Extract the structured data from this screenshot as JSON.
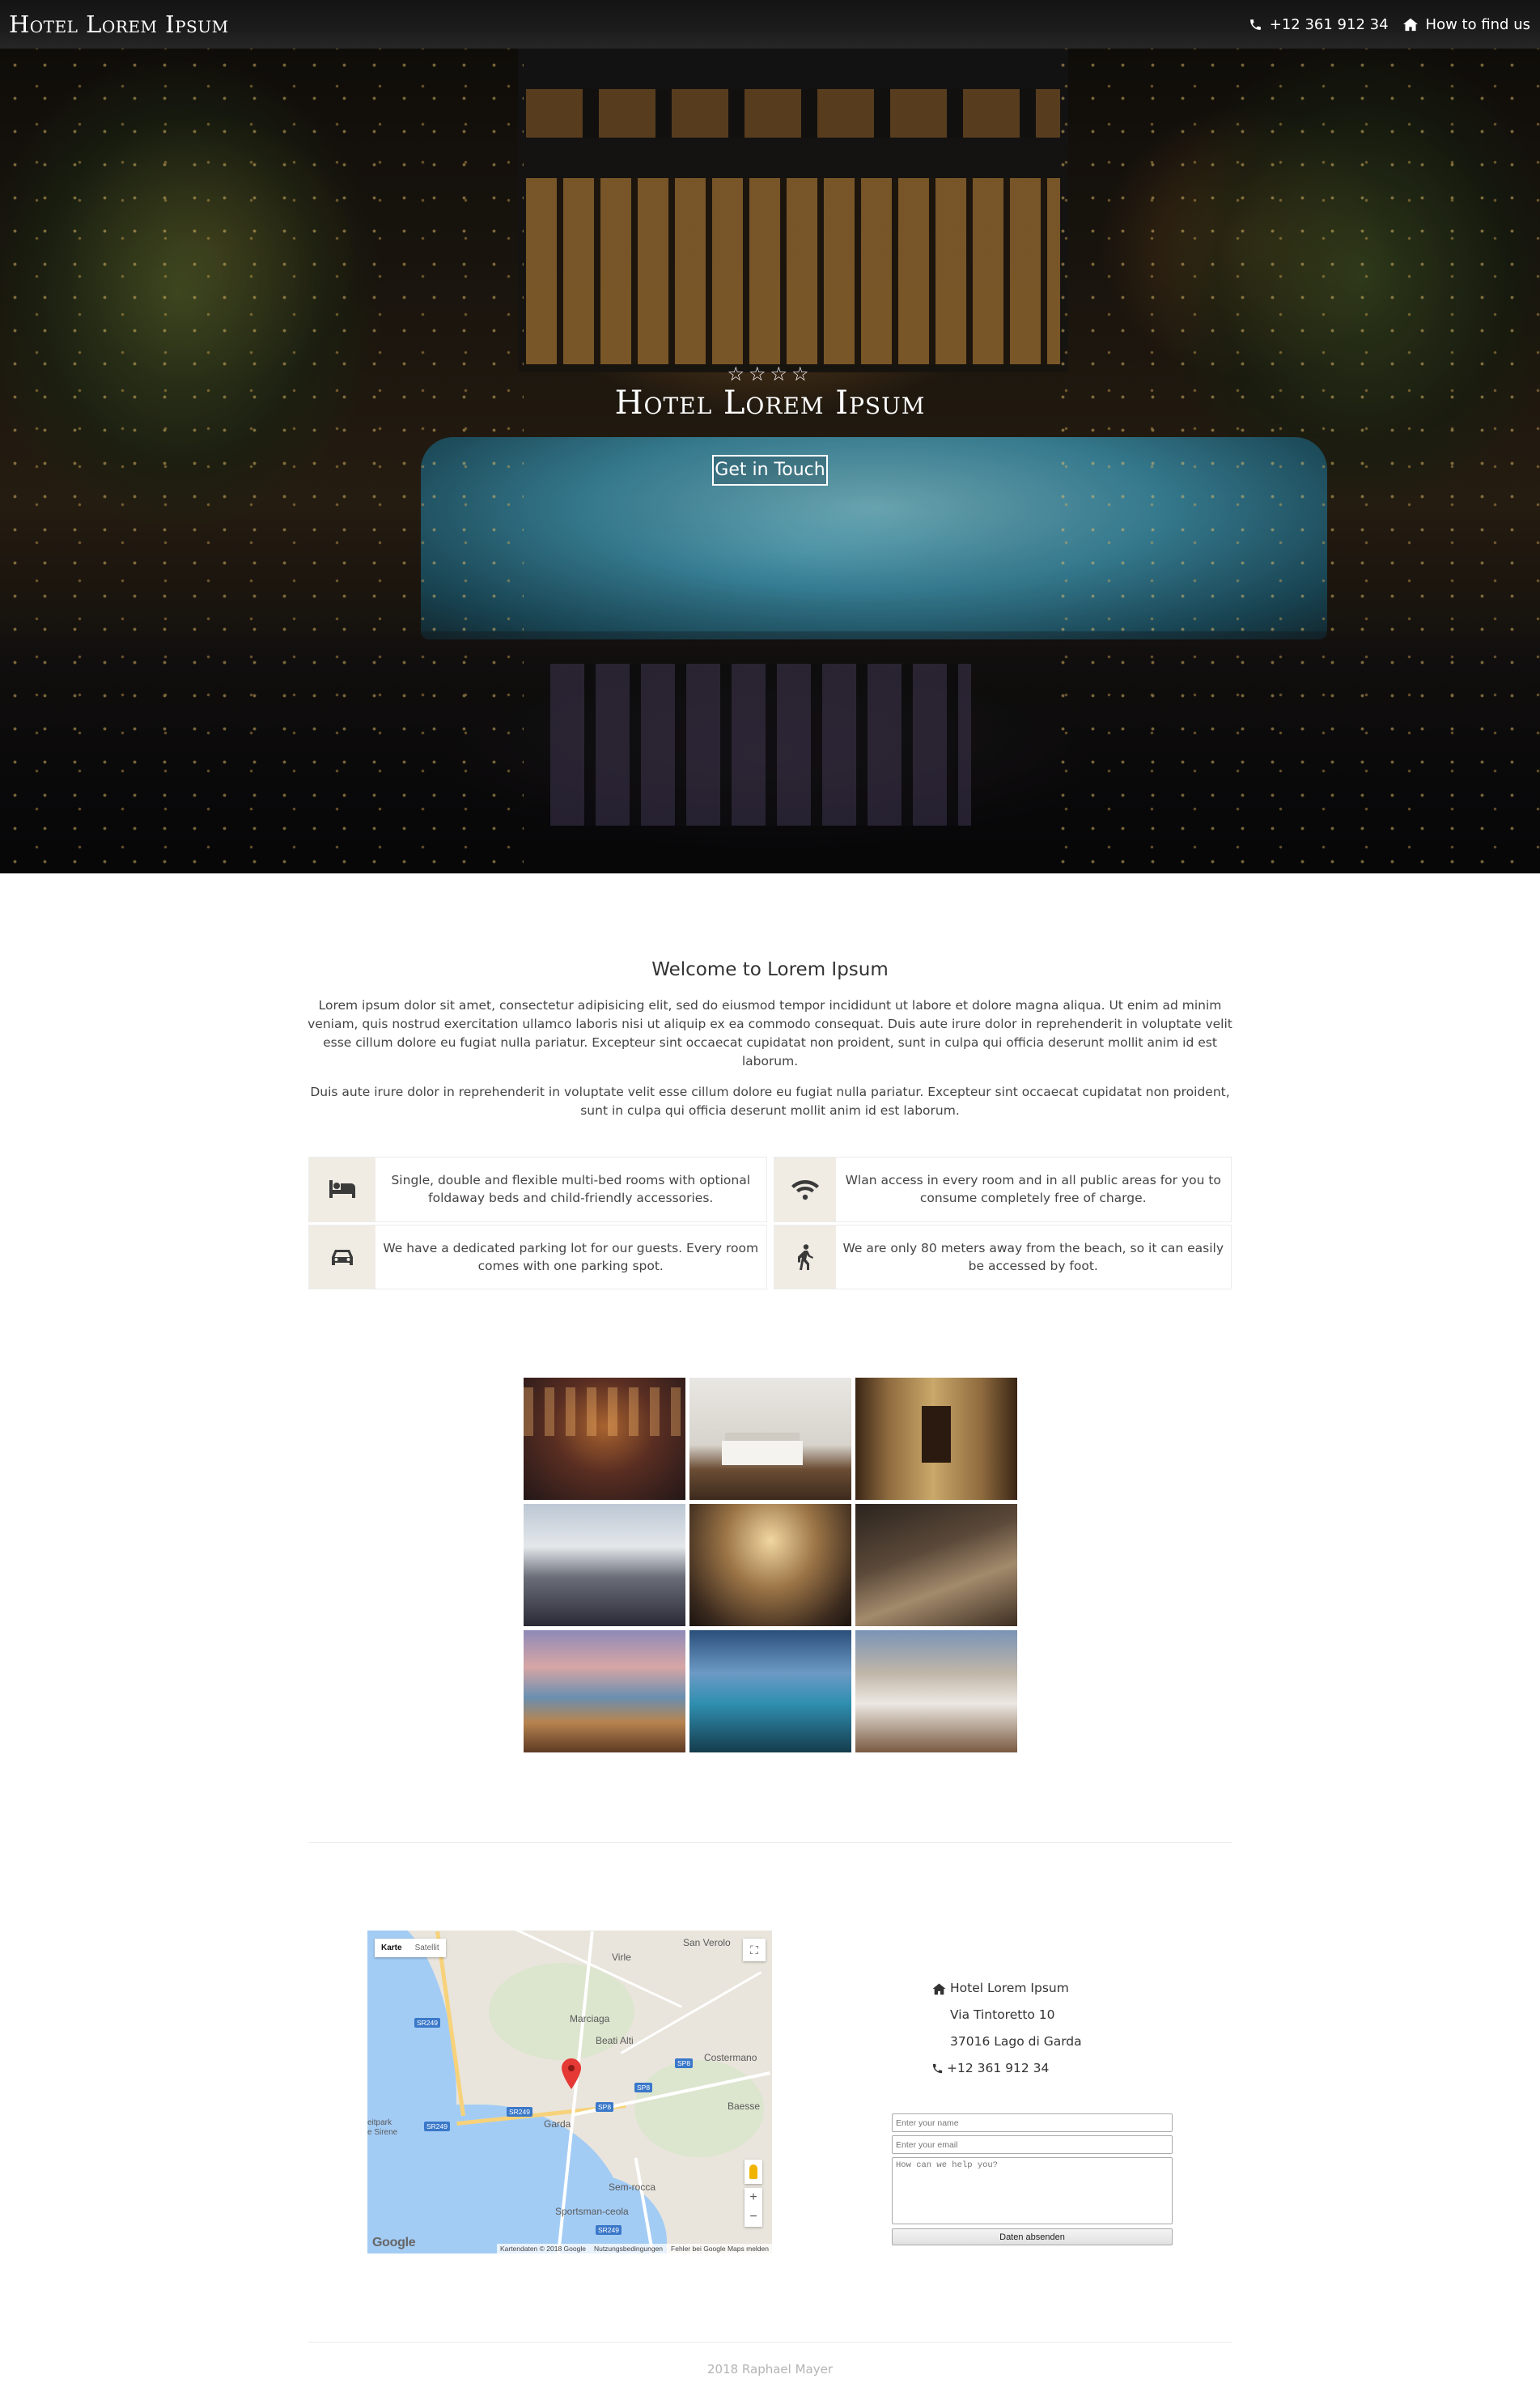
{
  "nav": {
    "brand": "Hotel Lorem Ipsum",
    "phone": "+12 361 912 34",
    "directions": "How to find us",
    "phone_icon": "phone-icon",
    "directions_icon": "home-icon"
  },
  "hero": {
    "stars": "☆☆☆☆",
    "star_count": 4,
    "title": "Hotel Lorem Ipsum",
    "cta": "Get in Touch"
  },
  "welcome": {
    "title": "Welcome to Lorem Ipsum",
    "paragraphs": [
      "Lorem ipsum dolor sit amet, consectetur adipisicing elit, sed do eiusmod tempor incididunt ut labore et dolore magna aliqua. Ut enim ad minim veniam, quis nostrud exercitation ullamco laboris nisi ut aliquip ex ea commodo consequat. Duis aute irure dolor in reprehenderit in voluptate velit esse cillum dolore eu fugiat nulla pariatur. Excepteur sint occaecat cupidatat non proident, sunt in culpa qui officia deserunt mollit anim id est laborum.",
      "Duis aute irure dolor in reprehenderit in voluptate velit esse cillum dolore eu fugiat nulla pariatur. Excepteur sint occaecat cupidatat non proident, sunt in culpa qui officia deserunt mollit anim id est laborum."
    ]
  },
  "features": [
    {
      "icon": "bed-icon",
      "text": "Single, double and flexible multi-bed rooms with optional foldaway beds and child-friendly accessories."
    },
    {
      "icon": "wifi-icon",
      "text": "Wlan access in every room and in all public areas for you to consume completely free of charge."
    },
    {
      "icon": "car-icon",
      "text": "We have a dedicated parking lot for our guests. Every room comes with one parking spot."
    },
    {
      "icon": "walking-icon",
      "text": "We are only 80 meters away from the beach, so it can easily be accessed by foot."
    }
  ],
  "gallery": [
    {
      "subject": "hotel-bar"
    },
    {
      "subject": "bedroom-white"
    },
    {
      "subject": "corridor"
    },
    {
      "subject": "restaurant-terrace"
    },
    {
      "subject": "lobby"
    },
    {
      "subject": "suite"
    },
    {
      "subject": "balcony-sunset"
    },
    {
      "subject": "bedroom-seaview"
    },
    {
      "subject": "dining-hall"
    }
  ],
  "map": {
    "type_map": "Karte",
    "type_satellite": "Satellit",
    "places": [
      "Virle",
      "San Verolo",
      "Marciaga",
      "Beati Alti",
      "Costermano",
      "Garda",
      "Baesse",
      "Sem-rocca",
      "Sportsman-ceola",
      "eitpark",
      "e Sirene"
    ],
    "roads": [
      "SR249",
      "SR249",
      "SR249",
      "SP8",
      "SP8",
      "SP8",
      "SR249"
    ],
    "logo": "Google",
    "attribution": [
      "Kartendaten © 2018 Google",
      "Nutzungsbedingungen",
      "Fehler bei Google Maps melden"
    ]
  },
  "contact": {
    "name": "Hotel Lorem Ipsum",
    "street": "Via Tintoretto 10",
    "city": "37016 Lago di Garda",
    "phone": "+12 361 912 34",
    "form": {
      "name_placeholder": "Enter your name",
      "email_placeholder": "Enter your email",
      "message_placeholder": "How can we help you?",
      "submit": "Daten absenden"
    }
  },
  "footer": "2018 Raphael Mayer"
}
